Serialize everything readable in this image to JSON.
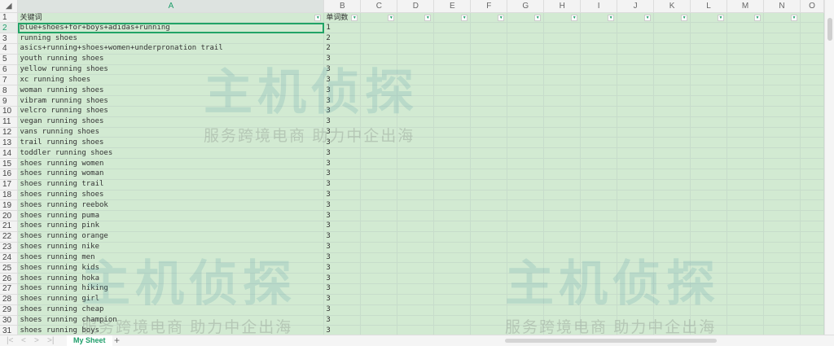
{
  "columns": [
    "A",
    "B",
    "C",
    "D",
    "E",
    "F",
    "G",
    "H",
    "I",
    "J",
    "K",
    "L",
    "M",
    "N",
    "O"
  ],
  "header_row": {
    "keyword": "关键词",
    "word_count": "单词数"
  },
  "rows": [
    {
      "n": "2",
      "k": "blue+shoes+for+boys+adidas+running",
      "v": "1"
    },
    {
      "n": "3",
      "k": "running shoes",
      "v": "2"
    },
    {
      "n": "4",
      "k": "asics+running+shoes+women+underpronation trail",
      "v": "2"
    },
    {
      "n": "5",
      "k": "youth running shoes",
      "v": "3"
    },
    {
      "n": "6",
      "k": "yellow running shoes",
      "v": "3"
    },
    {
      "n": "7",
      "k": "xc running shoes",
      "v": "3"
    },
    {
      "n": "8",
      "k": "woman running shoes",
      "v": "3"
    },
    {
      "n": "9",
      "k": "vibram running shoes",
      "v": "3"
    },
    {
      "n": "10",
      "k": "velcro running shoes",
      "v": "3"
    },
    {
      "n": "11",
      "k": "vegan running shoes",
      "v": "3"
    },
    {
      "n": "12",
      "k": "vans running shoes",
      "v": "3"
    },
    {
      "n": "13",
      "k": "trail running shoes",
      "v": "3"
    },
    {
      "n": "14",
      "k": "toddler running shoes",
      "v": "3"
    },
    {
      "n": "15",
      "k": "shoes running women",
      "v": "3"
    },
    {
      "n": "16",
      "k": "shoes running woman",
      "v": "3"
    },
    {
      "n": "17",
      "k": "shoes running trail",
      "v": "3"
    },
    {
      "n": "18",
      "k": "shoes running shoes",
      "v": "3"
    },
    {
      "n": "19",
      "k": "shoes running reebok",
      "v": "3"
    },
    {
      "n": "20",
      "k": "shoes running puma",
      "v": "3"
    },
    {
      "n": "21",
      "k": "shoes running pink",
      "v": "3"
    },
    {
      "n": "22",
      "k": "shoes running orange",
      "v": "3"
    },
    {
      "n": "23",
      "k": "shoes running nike",
      "v": "3"
    },
    {
      "n": "24",
      "k": "shoes running men",
      "v": "3"
    },
    {
      "n": "25",
      "k": "shoes running kids",
      "v": "3"
    },
    {
      "n": "26",
      "k": "shoes running hoka",
      "v": "3"
    },
    {
      "n": "27",
      "k": "shoes running hiking",
      "v": "3"
    },
    {
      "n": "28",
      "k": "shoes running girl",
      "v": "3"
    },
    {
      "n": "29",
      "k": "shoes running cheap",
      "v": "3"
    },
    {
      "n": "30",
      "k": "shoes running champion",
      "v": "3"
    },
    {
      "n": "31",
      "k": "shoes running boys",
      "v": "3"
    }
  ],
  "sheet_tab": "My Sheet",
  "watermark": {
    "title": "主机侦探",
    "subtitle": "服务跨境电商 助力中企出海"
  },
  "colors": {
    "accent": "#1f9e6a",
    "cell_fill": "#d2ead2"
  }
}
